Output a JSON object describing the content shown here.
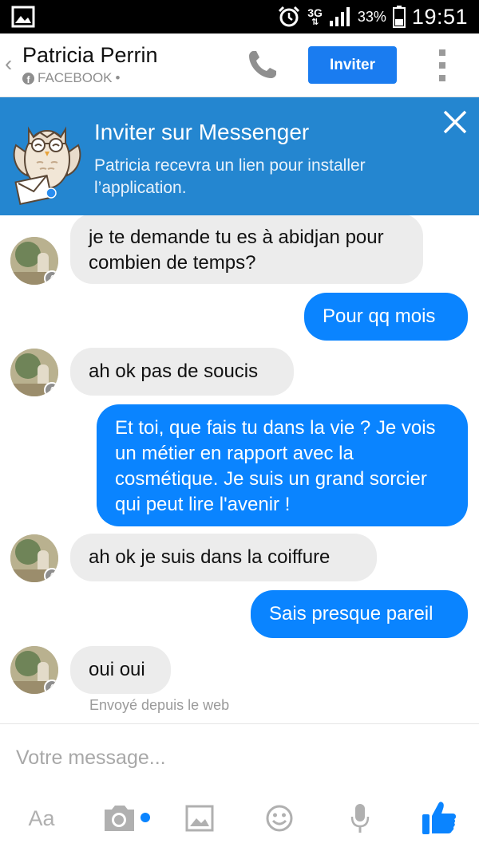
{
  "status_bar": {
    "network": "3G",
    "battery": "33%",
    "time": "19:51"
  },
  "header": {
    "contact_name": "Patricia Perrin",
    "source": "FACEBOOK",
    "source_suffix": "•",
    "invite_label": "Inviter"
  },
  "banner": {
    "title": "Inviter sur Messenger",
    "text": "Patricia recevra un lien pour installer l’application."
  },
  "messages": [
    {
      "from": "them",
      "text": "je te demande tu es à abidjan pour combien de temps?"
    },
    {
      "from": "me",
      "text": "Pour qq mois"
    },
    {
      "from": "them",
      "text": "ah ok pas de soucis"
    },
    {
      "from": "me",
      "text": "Et toi, que fais tu dans la vie ? Je vois un métier en rapport avec la cosmétique. Je suis un grand sorcier qui peut lire l'avenir !"
    },
    {
      "from": "them",
      "text": "ah ok je suis dans la coiffure"
    },
    {
      "from": "me",
      "text": "Sais presque pareil"
    },
    {
      "from": "them",
      "text": "oui oui"
    }
  ],
  "sent_from_web": "Envoyé depuis le web",
  "composer": {
    "placeholder": "Votre message...",
    "text_tool_label": "Aa"
  },
  "colors": {
    "accent": "#0a84ff",
    "banner": "#2486d0",
    "incoming_bubble": "#ececec"
  },
  "icons": [
    "gallery-icon",
    "alarm-icon",
    "signal-icon",
    "battery-icon",
    "back-chevron-icon",
    "phone-icon",
    "kebab-menu-icon",
    "owl-mascot-icon",
    "close-icon",
    "camera-icon",
    "image-icon",
    "emoji-icon",
    "microphone-icon",
    "thumbs-up-icon"
  ]
}
